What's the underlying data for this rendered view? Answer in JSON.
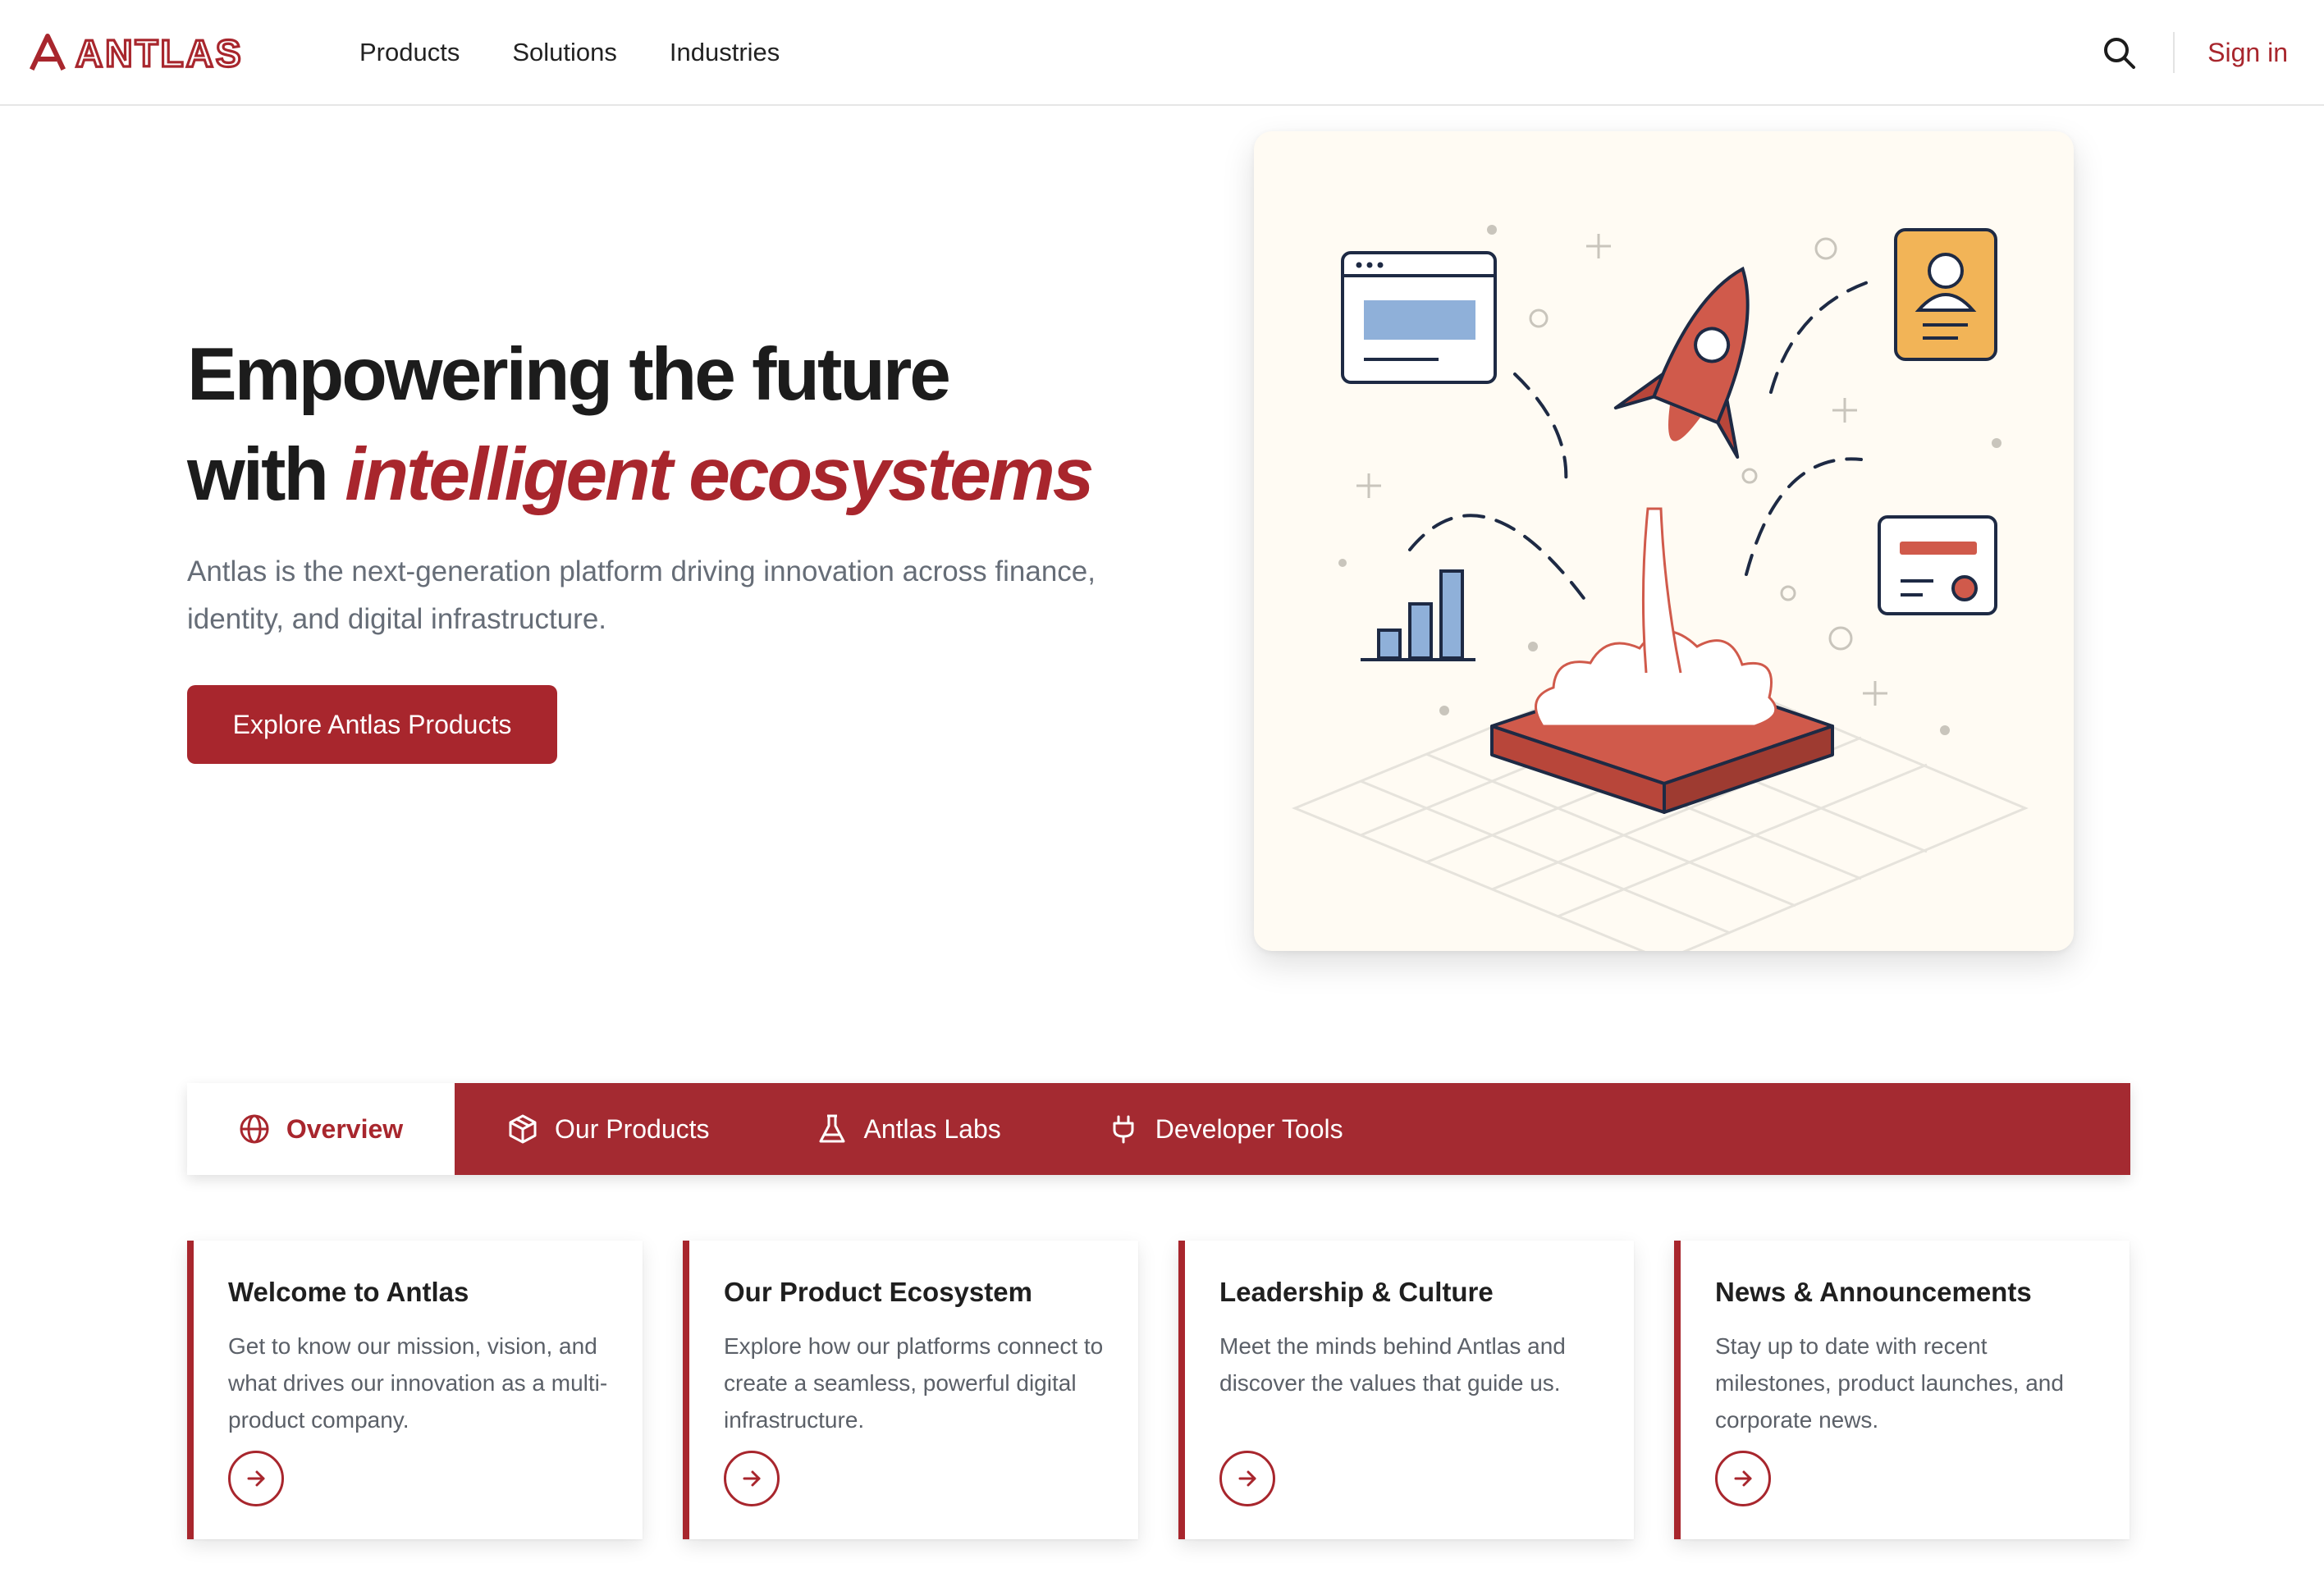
{
  "brand": {
    "name": "ANTLAS",
    "color": "#a8262d"
  },
  "nav": {
    "items": [
      "Products",
      "Solutions",
      "Industries"
    ]
  },
  "header": {
    "search_icon": "search-icon",
    "signin_label": "Sign in"
  },
  "hero": {
    "title_line1": "Empowering the future",
    "title_line2_prefix": "with ",
    "title_line2_accent": "intelligent ecosystems",
    "subtitle": "Antlas is the next-generation platform driving innovation across finance, identity, and digital infrastructure.",
    "cta_label": "Explore Antlas Products",
    "illustration": "rocket-launch-illustration"
  },
  "tabs": [
    {
      "label": "Overview",
      "icon": "globe-icon",
      "active": true
    },
    {
      "label": "Our Products",
      "icon": "cube-icon",
      "active": false
    },
    {
      "label": "Antlas Labs",
      "icon": "flask-icon",
      "active": false
    },
    {
      "label": "Developer Tools",
      "icon": "plug-icon",
      "active": false
    }
  ],
  "cards": [
    {
      "title": "Welcome to Antlas",
      "description": "Get to know our mission, vision, and what drives our innovation as a multi-product company."
    },
    {
      "title": "Our Product Ecosystem",
      "description": "Explore how our platforms connect to create a seamless, powerful digital infrastructure."
    },
    {
      "title": "Leadership & Culture",
      "description": "Meet the minds behind Antlas and discover the values that guide us."
    },
    {
      "title": "News & Announcements",
      "description": "Stay up to date with recent milestones, product launches, and corporate news."
    }
  ],
  "colors": {
    "accent": "#a8262d",
    "tabbar": "#a42a31",
    "illustration_bg": "#fffbf3",
    "muted_text": "#666d77"
  }
}
